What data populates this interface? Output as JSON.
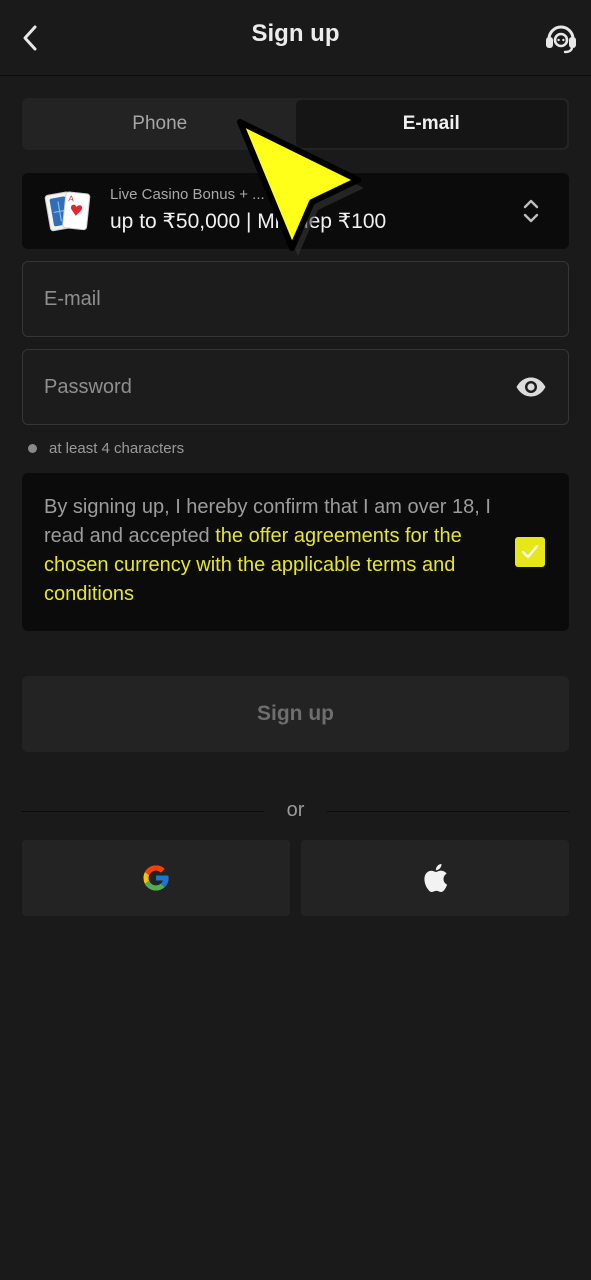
{
  "header": {
    "title": "Sign up",
    "back_icon": "chevron-left-icon",
    "support_icon": "headset-icon"
  },
  "tabs": [
    {
      "label": "Phone",
      "active": false
    },
    {
      "label": "E-mail",
      "active": true
    }
  ],
  "bonus": {
    "label": "Live Casino Bonus + ...",
    "value": "up to ₹50,000 | Min dep ₹100",
    "icon": "playing-cards-icon",
    "selector_icon": "chevron-up-down-icon"
  },
  "form": {
    "email_placeholder": "E-mail",
    "email_value": "",
    "password_placeholder": "Password",
    "password_value": "",
    "password_toggle_icon": "eye-icon",
    "password_hint": "at least 4 characters"
  },
  "terms": {
    "text_before": "By signing up, I hereby confirm that I am over 18, I read and accepted ",
    "link_text": "the offer agreements for the chosen currency with the applicable terms and conditions",
    "checked": true
  },
  "submit": {
    "label": "Sign up"
  },
  "divider": {
    "label": "or"
  },
  "social": {
    "google_icon": "google-icon",
    "apple_icon": "apple-icon"
  },
  "colors": {
    "background": "#1a1a1a",
    "accent": "#e6e619",
    "surface": "#232323",
    "panel": "#0b0b0b"
  }
}
